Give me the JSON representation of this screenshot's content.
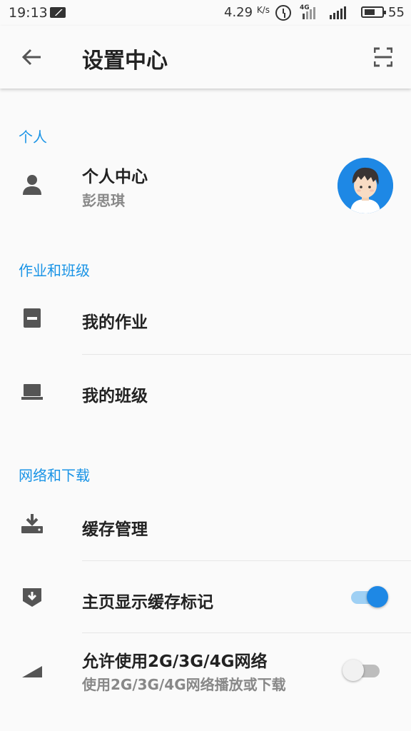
{
  "status_bar": {
    "time": "19:13",
    "speed_value": "4.29",
    "speed_unit": "K/s",
    "network_type": "4G",
    "battery": "55"
  },
  "toolbar": {
    "title": "设置中心"
  },
  "sections": {
    "personal": {
      "header": "个人",
      "personal_center": {
        "title": "个人中心",
        "subtitle": "彭思琪"
      }
    },
    "homework_class": {
      "header": "作业和班级",
      "my_homework": {
        "title": "我的作业"
      },
      "my_class": {
        "title": "我的班级"
      }
    },
    "network_download": {
      "header": "网络和下载",
      "cache_manage": {
        "title": "缓存管理"
      },
      "show_cache_mark": {
        "title": "主页显示缓存标记",
        "enabled": true
      },
      "allow_mobile": {
        "title": "允许使用2G/3G/4G网络",
        "subtitle": "使用2G/3G/4G网络播放或下载",
        "enabled": false
      }
    }
  },
  "colors": {
    "accent": "#1a94e6",
    "icon": "#555555",
    "toggle_on": "#1e88e5",
    "toggle_on_track": "#9fd0f4",
    "toggle_off": "#f1f1f1",
    "toggle_off_track": "#bdbdbd"
  },
  "icons": {
    "back": "arrow-back-icon",
    "scan": "scan-icon",
    "person": "person-icon",
    "homework": "homework-icon",
    "class": "class-icon",
    "download": "download-icon",
    "cache_mark": "cache-mark-icon",
    "signal": "signal-icon"
  }
}
